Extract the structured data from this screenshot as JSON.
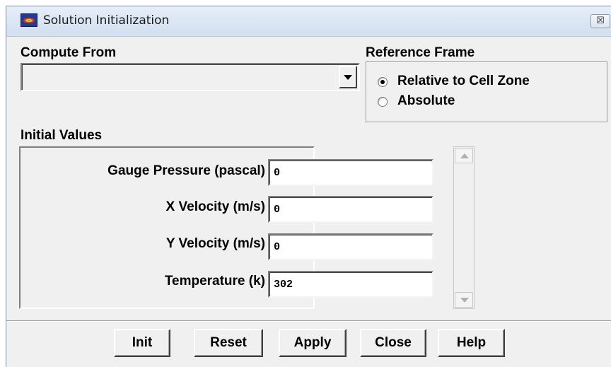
{
  "window": {
    "title": "Solution Initialization",
    "close_glyph": "☒",
    "icon": "fluent-app-icon"
  },
  "compute_from": {
    "label": "Compute From",
    "selected": "",
    "dropdown_icon": "chevron-down-icon"
  },
  "reference_frame": {
    "label": "Reference Frame",
    "options": [
      {
        "label": "Relative to Cell Zone",
        "selected": true
      },
      {
        "label": "Absolute",
        "selected": false
      }
    ]
  },
  "initial_values": {
    "label": "Initial Values",
    "fields": [
      {
        "label": "Gauge Pressure (pascal)",
        "value": "0"
      },
      {
        "label": "X Velocity (m/s)",
        "value": "0"
      },
      {
        "label": "Y Velocity (m/s)",
        "value": "0"
      },
      {
        "label": "Temperature (k)",
        "value": "302"
      }
    ]
  },
  "buttons": {
    "init": "Init",
    "reset": "Reset",
    "apply": "Apply",
    "close": "Close",
    "help": "Help"
  },
  "colors": {
    "dialog_bg": "#f0f0f0",
    "titlebar": "#d2dff0"
  }
}
